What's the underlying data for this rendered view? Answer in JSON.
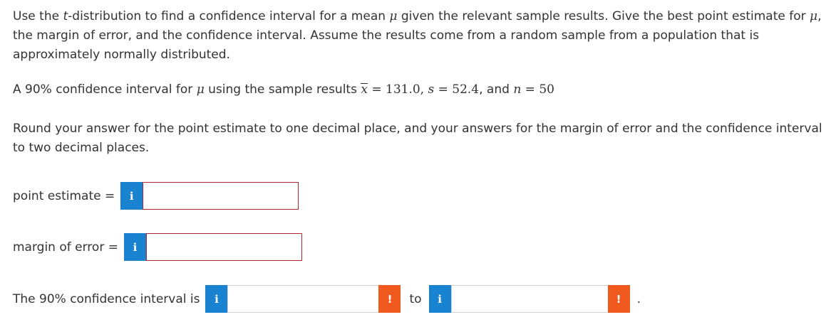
{
  "question": {
    "intro_part1": "Use the ",
    "intro_t": "t",
    "intro_part2": "-distribution to find a confidence interval for a mean ",
    "intro_mu1": "μ",
    "intro_part3": " given the relevant sample results. Give the best point estimate for ",
    "intro_mu2": "μ",
    "intro_part4": ", the margin of error, and the confidence interval. Assume the results come from a random sample from a population that is approximately normally distributed.",
    "setup_part1": "A 90% confidence interval for ",
    "setup_mu": "μ",
    "setup_part2": " using the sample results ",
    "xbar_symbol": "x",
    "xbar_value": " = 131.0, ",
    "s_symbol": "s",
    "s_value": " = 52.4",
    "setup_and": ", and ",
    "n_symbol": "n",
    "n_value": " = 50",
    "rounding_instructions": "Round your answer for the point estimate to one decimal place, and your answers for the margin of error and the confidence interval to two decimal places."
  },
  "answers": {
    "point_estimate": {
      "label": "point estimate =",
      "value": "",
      "info_icon": "i"
    },
    "margin_of_error": {
      "label": "margin of error =",
      "value": "",
      "info_icon": "i"
    },
    "confidence_interval": {
      "label": "The 90% confidence interval is",
      "lower_value": "",
      "upper_value": "",
      "to_label": "to",
      "period": ".",
      "info_icon": "i",
      "warn_icon": "!"
    }
  },
  "colors": {
    "info_button": "#1982d1",
    "warn_button": "#f05a1e",
    "error_border": "#b0262d"
  }
}
